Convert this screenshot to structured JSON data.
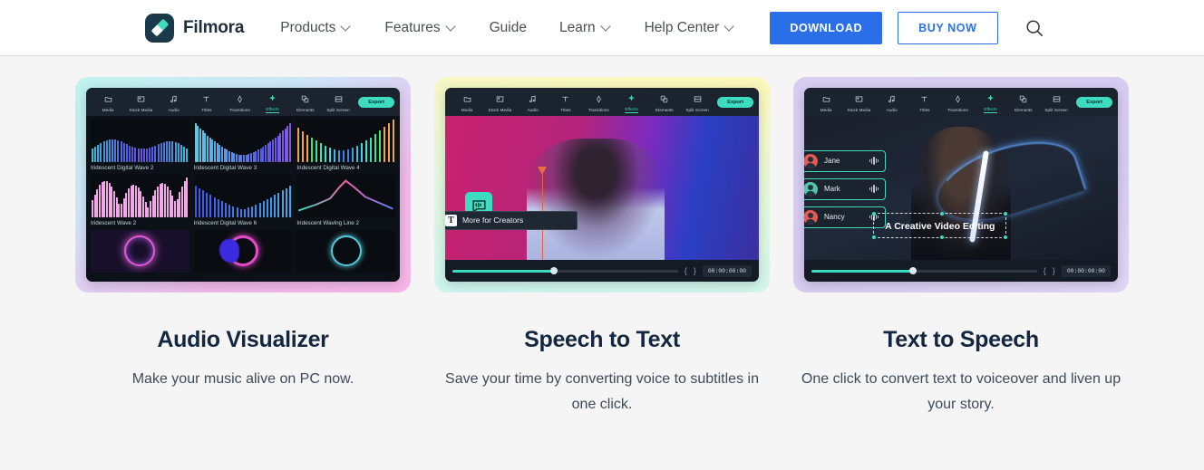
{
  "nav": {
    "brand": "Filmora",
    "logo_icon": "filmora-logo-icon",
    "links": [
      {
        "label": "Products",
        "has_caret": true
      },
      {
        "label": "Features",
        "has_caret": true
      },
      {
        "label": "Guide",
        "has_caret": false
      },
      {
        "label": "Learn",
        "has_caret": true
      },
      {
        "label": "Help Center",
        "has_caret": true
      }
    ],
    "download_label": "DOWNLOAD",
    "buy_label": "BUY NOW",
    "search_icon": "search-icon",
    "colors": {
      "accent_blue": "#2b6fe8",
      "text": "#4a4f57",
      "border": "#d9d9d9"
    }
  },
  "editor_toolbar": {
    "items": [
      "Media",
      "Stock Media",
      "Audio",
      "Titles",
      "Transitions",
      "Effects",
      "Elements",
      "Split Screen"
    ],
    "active": "Effects",
    "export_label": "Export",
    "accent": "#3ddbc0"
  },
  "timeline": {
    "timecode": "00:00:00:00",
    "in_brace": "{",
    "out_brace": "}",
    "progress_pct": 45
  },
  "cards": [
    {
      "id": "audio-visualizer",
      "title": "Audio Visualizer",
      "desc": "Make your music alive on PC now.",
      "gradient_from": "#bff3ee",
      "gradient_to": "#f7b6e8",
      "effects": [
        "Iridescent Digital Wave 2",
        "Iridescent Digital Wave 3",
        "Iridescent Digital Wave 4",
        "Iridescent Wave 2",
        "Iridescent Digital Wave 6",
        "Iridescent Waving Line 2"
      ]
    },
    {
      "id": "speech-to-text",
      "title": "Speech to Text",
      "desc": "Save your time by converting voice to subtitles in one click.",
      "gradient_from": "#fcf7ba",
      "gradient_to": "#cdf6f0",
      "subtitle_text": "More for Creators",
      "subtitle_icon": "text-tool-icon",
      "sticker_icon": "speech-bubble-text-icon"
    },
    {
      "id": "text-to-speech",
      "title": "Text to Speech",
      "desc": "One click to convert text to voiceover and liven up your story.",
      "gradient_from": "#d8cdf2",
      "gradient_to": "#e0d6f5",
      "voices": [
        {
          "name": "Jane",
          "avatar_color": "#e8584f"
        },
        {
          "name": "Mark",
          "avatar_color": "#4fc7a8"
        },
        {
          "name": "Nancy",
          "avatar_color": "#e8584f"
        }
      ],
      "title_overlay": "A Creative Video Editing"
    }
  ]
}
